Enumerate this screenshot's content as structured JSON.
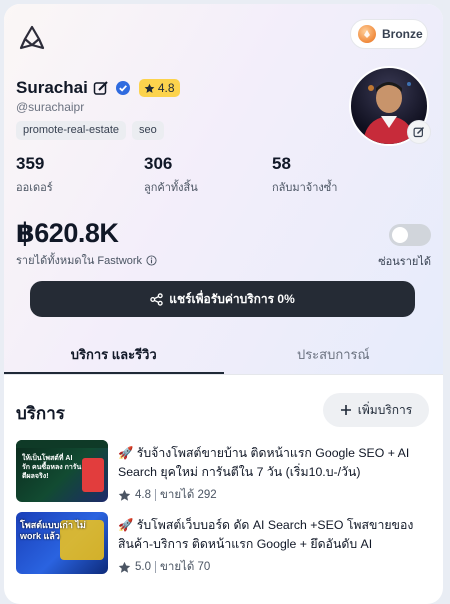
{
  "badge": {
    "level": "Bronze",
    "icon": "bronze-medal-icon"
  },
  "profile": {
    "name": "Surachai",
    "handle": "@surachaipr",
    "rating": "4.8",
    "tags": [
      "promote-real-estate",
      "seo"
    ]
  },
  "stats": [
    {
      "value": "359",
      "label": "ออเดอร์"
    },
    {
      "value": "306",
      "label": "ลูกค้าทั้งสิ้น"
    },
    {
      "value": "58",
      "label": "กลับมาจ้างซ้ำ"
    }
  ],
  "income": {
    "value": "฿620.8K",
    "label": "รายได้ทั้งหมดใน Fastwork",
    "toggle_label": "ซ่อนรายได้"
  },
  "share_button": "แชร์เพื่อรับค่าบริการ 0%",
  "tabs": [
    {
      "label": "บริการ และรีวิว",
      "active": true
    },
    {
      "label": "ประสบการณ์",
      "active": false
    }
  ],
  "services_section": {
    "title": "บริการ",
    "add_label": "เพิ่มบริการ"
  },
  "services": [
    {
      "title": "🚀 รับจ้างโพสต์ขายบ้าน ติดหน้าแรก Google SEO + AI Search ยุคใหม่ การันตีใน 7 วัน (เริ่ม10.บ-/วัน)",
      "rating": "4.8",
      "sold": "ขายได้ 292",
      "thumb_text": "ให้เป็นโพสต์ที่ AI รัก คนซื้อหลง การันตีผลจริง!"
    },
    {
      "title": "🚀 รับโพสต์เว็บบอร์ด ดัด AI Search +SEO โพสขายของ สินค้า-บริการ ติดหน้าแรก Google + ยึดอันดับ AI",
      "rating": "5.0",
      "sold": "ขายได้ 70",
      "thumb_text": "โพสต์แบบเก่า ไม่ work แล้ว"
    }
  ]
}
